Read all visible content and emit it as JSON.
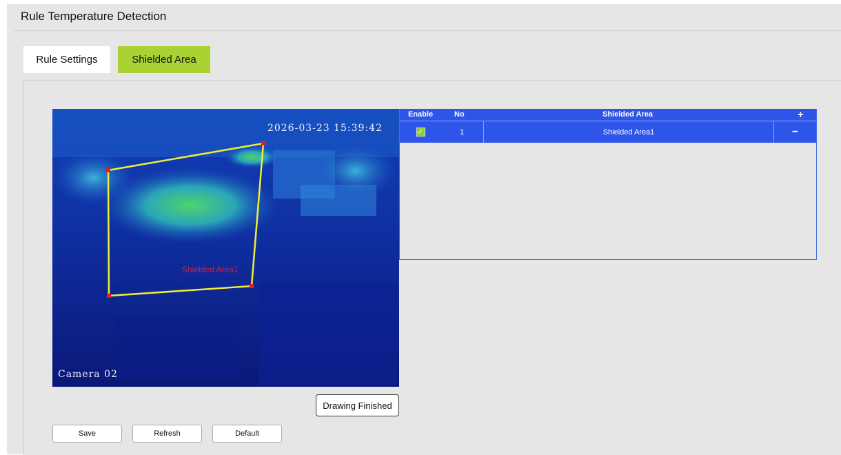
{
  "page": {
    "title": "Rule Temperature Detection"
  },
  "tabs": [
    {
      "label": "Rule Settings",
      "active": false
    },
    {
      "label": "Shielded Area",
      "active": true
    }
  ],
  "video": {
    "timestamp": "2026-03-23  15:39:42",
    "camera_label": "Camera  02",
    "polygon_label": "Shielded Area1"
  },
  "table": {
    "headers": {
      "enable": "Enable",
      "no": "No",
      "area": "Shielded Area",
      "add_icon": "plus-icon"
    },
    "rows": [
      {
        "enabled": true,
        "no": "1",
        "name": "Shielded Area1",
        "remove_icon": "minus-icon"
      }
    ]
  },
  "buttons": {
    "drawing_finished": "Drawing Finished",
    "save": "Save",
    "refresh": "Refresh",
    "default": "Default"
  },
  "colors": {
    "accent_tab": "#a9d234",
    "table_header": "#2d55e8",
    "polygon_line": "#f2ee33",
    "polygon_vertex": "#e81c1c"
  }
}
